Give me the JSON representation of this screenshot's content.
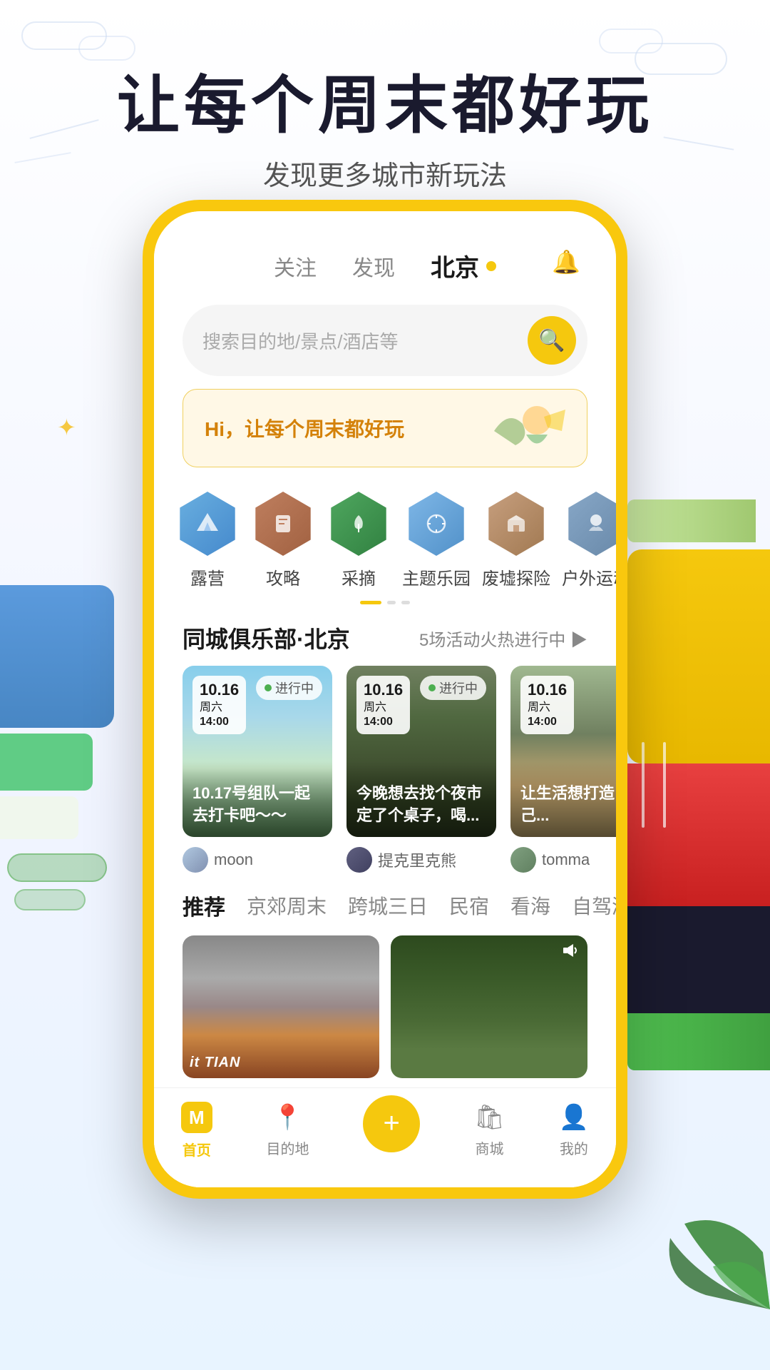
{
  "page": {
    "background_color": "#f0f4ff"
  },
  "headline": {
    "main": "让每个周末都好玩",
    "sub": "发现更多城市新玩法"
  },
  "phone": {
    "nav": {
      "items": [
        {
          "label": "关注",
          "active": false
        },
        {
          "label": "发现",
          "active": false
        },
        {
          "label": "北京",
          "active": true
        }
      ],
      "bell_icon": "🔔",
      "location_dot": "●"
    },
    "search": {
      "placeholder": "搜索目的地/景点/酒店等",
      "icon": "🔍"
    },
    "banner": {
      "text": "Hi，让每个周末都好玩"
    },
    "categories": [
      {
        "label": "露营",
        "icon": "⛺"
      },
      {
        "label": "攻略",
        "icon": "📄"
      },
      {
        "label": "采摘",
        "icon": "🍃"
      },
      {
        "label": "主题乐园",
        "icon": "🎡"
      },
      {
        "label": "废墟探险",
        "icon": "🏚"
      },
      {
        "label": "户外运动",
        "icon": "🏔"
      }
    ],
    "club_section": {
      "title": "同城俱乐部·北京",
      "more": "5场活动火热进行中 ▶",
      "activities": [
        {
          "date": "10.16",
          "day": "周六",
          "time": "14:00",
          "status": "进行中",
          "title": "10.17号组队一起去打卡吧～～",
          "user": "moon",
          "img_type": "building"
        },
        {
          "date": "10.16",
          "day": "周六",
          "time": "14:00",
          "status": "进行中",
          "title": "今晚想去找个夜市定了个桌子，喝...",
          "user": "提克里克熊",
          "img_type": "forest"
        },
        {
          "date": "10.16",
          "day": "周六",
          "time": "14:00",
          "status": "",
          "title": "让生活想打造自己...",
          "user": "tomma",
          "img_type": "river"
        }
      ]
    },
    "rec_tabs": [
      {
        "label": "推荐",
        "active": true
      },
      {
        "label": "京郊周末",
        "active": false
      },
      {
        "label": "跨城三日",
        "active": false
      },
      {
        "label": "民宿",
        "active": false
      },
      {
        "label": "看海",
        "active": false
      },
      {
        "label": "自驾游",
        "active": false
      }
    ],
    "content_cards": [
      {
        "type": "forest",
        "overlay_text": "it TIAN"
      },
      {
        "type": "forest2",
        "sound": true
      }
    ],
    "bottom_nav": [
      {
        "label": "首页",
        "icon": "M",
        "active": true,
        "is_m": true
      },
      {
        "label": "目的地",
        "icon": "📍",
        "active": false
      },
      {
        "label": "",
        "icon": "+",
        "active": false,
        "is_plus": true
      },
      {
        "label": "商城",
        "icon": "🛍",
        "active": false
      },
      {
        "label": "我的",
        "icon": "👤",
        "active": false
      }
    ]
  }
}
